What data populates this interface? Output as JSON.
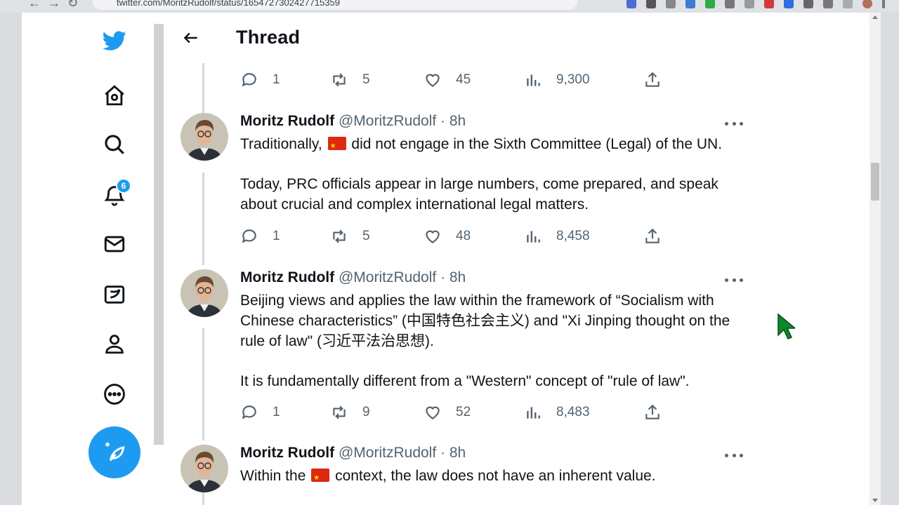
{
  "browser": {
    "url": "twitter.com/MoritzRudolf/status/1654727302427715359"
  },
  "nav": {
    "notifications_badge": "6",
    "items": [
      "twitter-logo-icon",
      "home-icon",
      "search-icon",
      "bell-icon",
      "mail-icon",
      "lists-icon",
      "profile-icon",
      "more-circle-icon"
    ]
  },
  "header": {
    "title": "Thread"
  },
  "colors": {
    "accent": "#1d9bf0",
    "muted_text": "#536471",
    "thread_line": "#cfd9de",
    "flag_red": "#de2910"
  },
  "tweets": [
    {
      "actions": {
        "replies": "1",
        "retweets": "5",
        "likes": "45",
        "views": "9,300"
      }
    },
    {
      "name": "Moritz Rudolf",
      "handle": "@MoritzRudolf",
      "time": "· 8h",
      "p1_pre": "Traditionally,",
      "p1_post": "did not engage in the Sixth Committee (Legal) of the UN.",
      "p2": "Today, PRC officials appear in large numbers, come prepared, and speak about crucial and complex international legal matters.",
      "actions": {
        "replies": "1",
        "retweets": "5",
        "likes": "48",
        "views": "8,458"
      }
    },
    {
      "name": "Moritz Rudolf",
      "handle": "@MoritzRudolf",
      "time": "· 8h",
      "p1": "Beijing views and applies the law within the framework of “Socialism with Chinese characteristics” (中国特色社会主义) and \"Xi Jinping thought on the rule of law\" (习近平法治思想).",
      "p2": "It is fundamentally different from a \"Western\" concept of \"rule of law\".",
      "actions": {
        "replies": "1",
        "retweets": "9",
        "likes": "52",
        "views": "8,483"
      }
    },
    {
      "name": "Moritz Rudolf",
      "handle": "@MoritzRudolf",
      "time": "· 8h",
      "p1_pre": "Within the",
      "p1_post": "context, the law does not have an inherent value."
    }
  ]
}
